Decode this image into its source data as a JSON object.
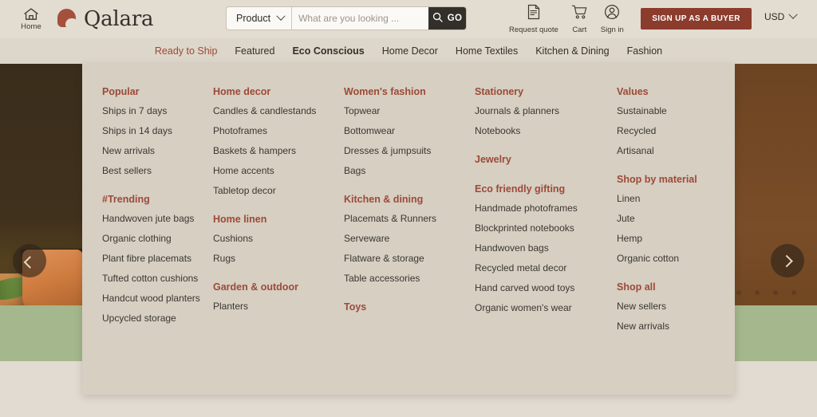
{
  "header": {
    "home_label": "Home",
    "home_icon": "home-icon",
    "brand_name": "Qalara",
    "search": {
      "category_value": "Product",
      "category_icon": "chevron-down-icon",
      "placeholder": "What are you looking ...",
      "search_icon": "search-icon",
      "go_label": "GO"
    },
    "actions": [
      {
        "label": "Request quote",
        "icon": "document-quote-icon"
      },
      {
        "label": "Cart",
        "icon": "shopping-cart-icon"
      },
      {
        "label": "Sign in",
        "icon": "user-account-icon"
      }
    ],
    "signup_label": "SIGN UP AS A BUYER",
    "currency_value": "USD",
    "currency_icon": "chevron-down-icon",
    "accent_color": "#8c3c2c"
  },
  "nav": {
    "items": [
      {
        "label": "Ready to Ship",
        "style": "red"
      },
      {
        "label": "Featured",
        "style": "normal"
      },
      {
        "label": "Eco Conscious",
        "style": "active"
      },
      {
        "label": "Home Decor",
        "style": "normal"
      },
      {
        "label": "Home Textiles",
        "style": "normal"
      },
      {
        "label": "Kitchen & Dining",
        "style": "normal"
      },
      {
        "label": "Fashion",
        "style": "normal"
      }
    ]
  },
  "megamenu": {
    "columns": [
      {
        "groups": [
          {
            "heading": "Popular",
            "links": [
              "Ships in 7 days",
              "Ships in 14 days",
              "New arrivals",
              "Best sellers"
            ]
          },
          {
            "heading": "#Trending",
            "links": [
              "Handwoven jute bags",
              "Organic clothing",
              "Plant fibre placemats",
              "Tufted cotton cushions",
              "Handcut wood planters",
              "Upcycled storage"
            ]
          }
        ]
      },
      {
        "groups": [
          {
            "heading": "Home decor",
            "links": [
              "Candles & candlestands",
              "Photoframes",
              "Baskets & hampers",
              "Home accents",
              "Tabletop decor"
            ]
          },
          {
            "heading": "Home linen",
            "links": [
              "Cushions",
              "Rugs"
            ]
          },
          {
            "heading": "Garden & outdoor",
            "links": [
              "Planters"
            ]
          }
        ]
      },
      {
        "groups": [
          {
            "heading": "Women's fashion",
            "links": [
              "Topwear",
              "Bottomwear",
              "Dresses & jumpsuits",
              "Bags"
            ]
          },
          {
            "heading": "Kitchen & dining",
            "links": [
              "Placemats & Runners",
              "Serveware",
              "Flatware & storage",
              "Table accessories"
            ]
          },
          {
            "heading": "Toys",
            "links": []
          }
        ]
      },
      {
        "groups": [
          {
            "heading": "Stationery",
            "links": [
              "Journals & planners",
              "Notebooks"
            ]
          },
          {
            "heading": "Jewelry",
            "links": []
          },
          {
            "heading": "Eco friendly gifting",
            "links": [
              "Handmade photoframes",
              "Blockprinted notebooks",
              "Handwoven bags",
              "Recycled metal decor",
              "Hand carved wood toys",
              "Organic women's wear"
            ]
          }
        ]
      },
      {
        "groups": [
          {
            "heading": "Values",
            "links": [
              "Sustainable",
              "Recycled",
              "Artisanal"
            ]
          },
          {
            "heading": "Shop by material",
            "links": [
              "Linen",
              "Jute",
              "Hemp",
              "Organic cotton"
            ]
          },
          {
            "heading": "Shop all",
            "links": [
              "New sellers",
              "New arrivals"
            ]
          }
        ]
      }
    ],
    "heading_color": "#9c4a38"
  },
  "hero": {
    "prev_icon": "chevron-left-icon",
    "next_icon": "chevron-right-icon",
    "dots_total": 5,
    "active_dot": 1
  }
}
